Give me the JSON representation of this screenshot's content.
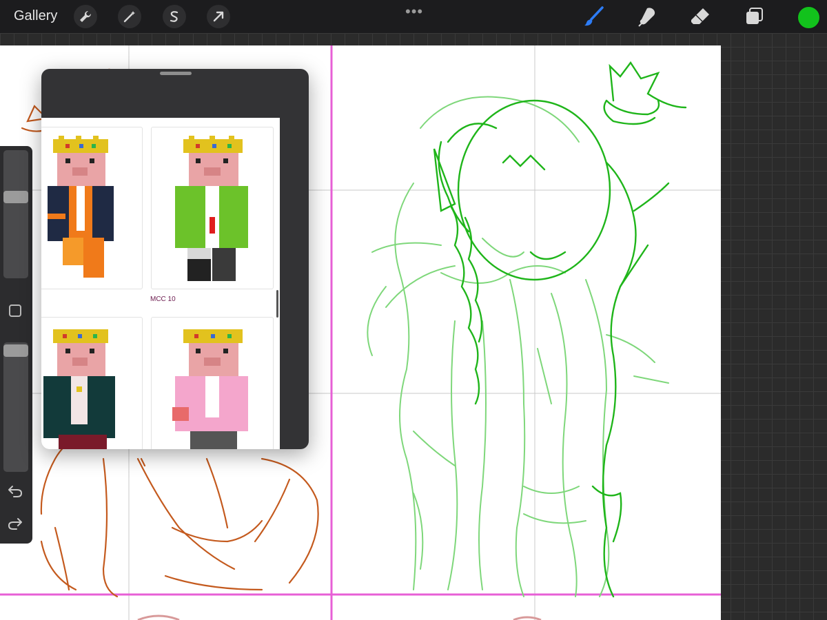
{
  "toolbar": {
    "gallery_label": "Gallery",
    "more_dots": "•••",
    "active_color": "#12c21c",
    "accent_color": "#2d7cf6",
    "left_tools": [
      "wrench-icon",
      "magic-wand-icon",
      "selection-icon",
      "transform-arrow-icon"
    ],
    "right_tools": [
      "brush-icon",
      "smudge-icon",
      "eraser-icon",
      "layers-icon"
    ]
  },
  "reference": {
    "items": [
      {
        "caption": ""
      },
      {
        "caption": "MCC 10"
      },
      {
        "caption": ""
      },
      {
        "caption": ""
      }
    ]
  },
  "sidebar": {
    "brush_size_level": 0.17,
    "opacity_level": 0.04,
    "undo_icon": "undo-icon",
    "redo_icon": "redo-icon"
  },
  "colors": {
    "guide_magenta": "#e75fd6",
    "sketch_green": "#1fb51a",
    "sketch_light_green": "#7ed77a",
    "sketch_orange": "#c45a1e"
  }
}
